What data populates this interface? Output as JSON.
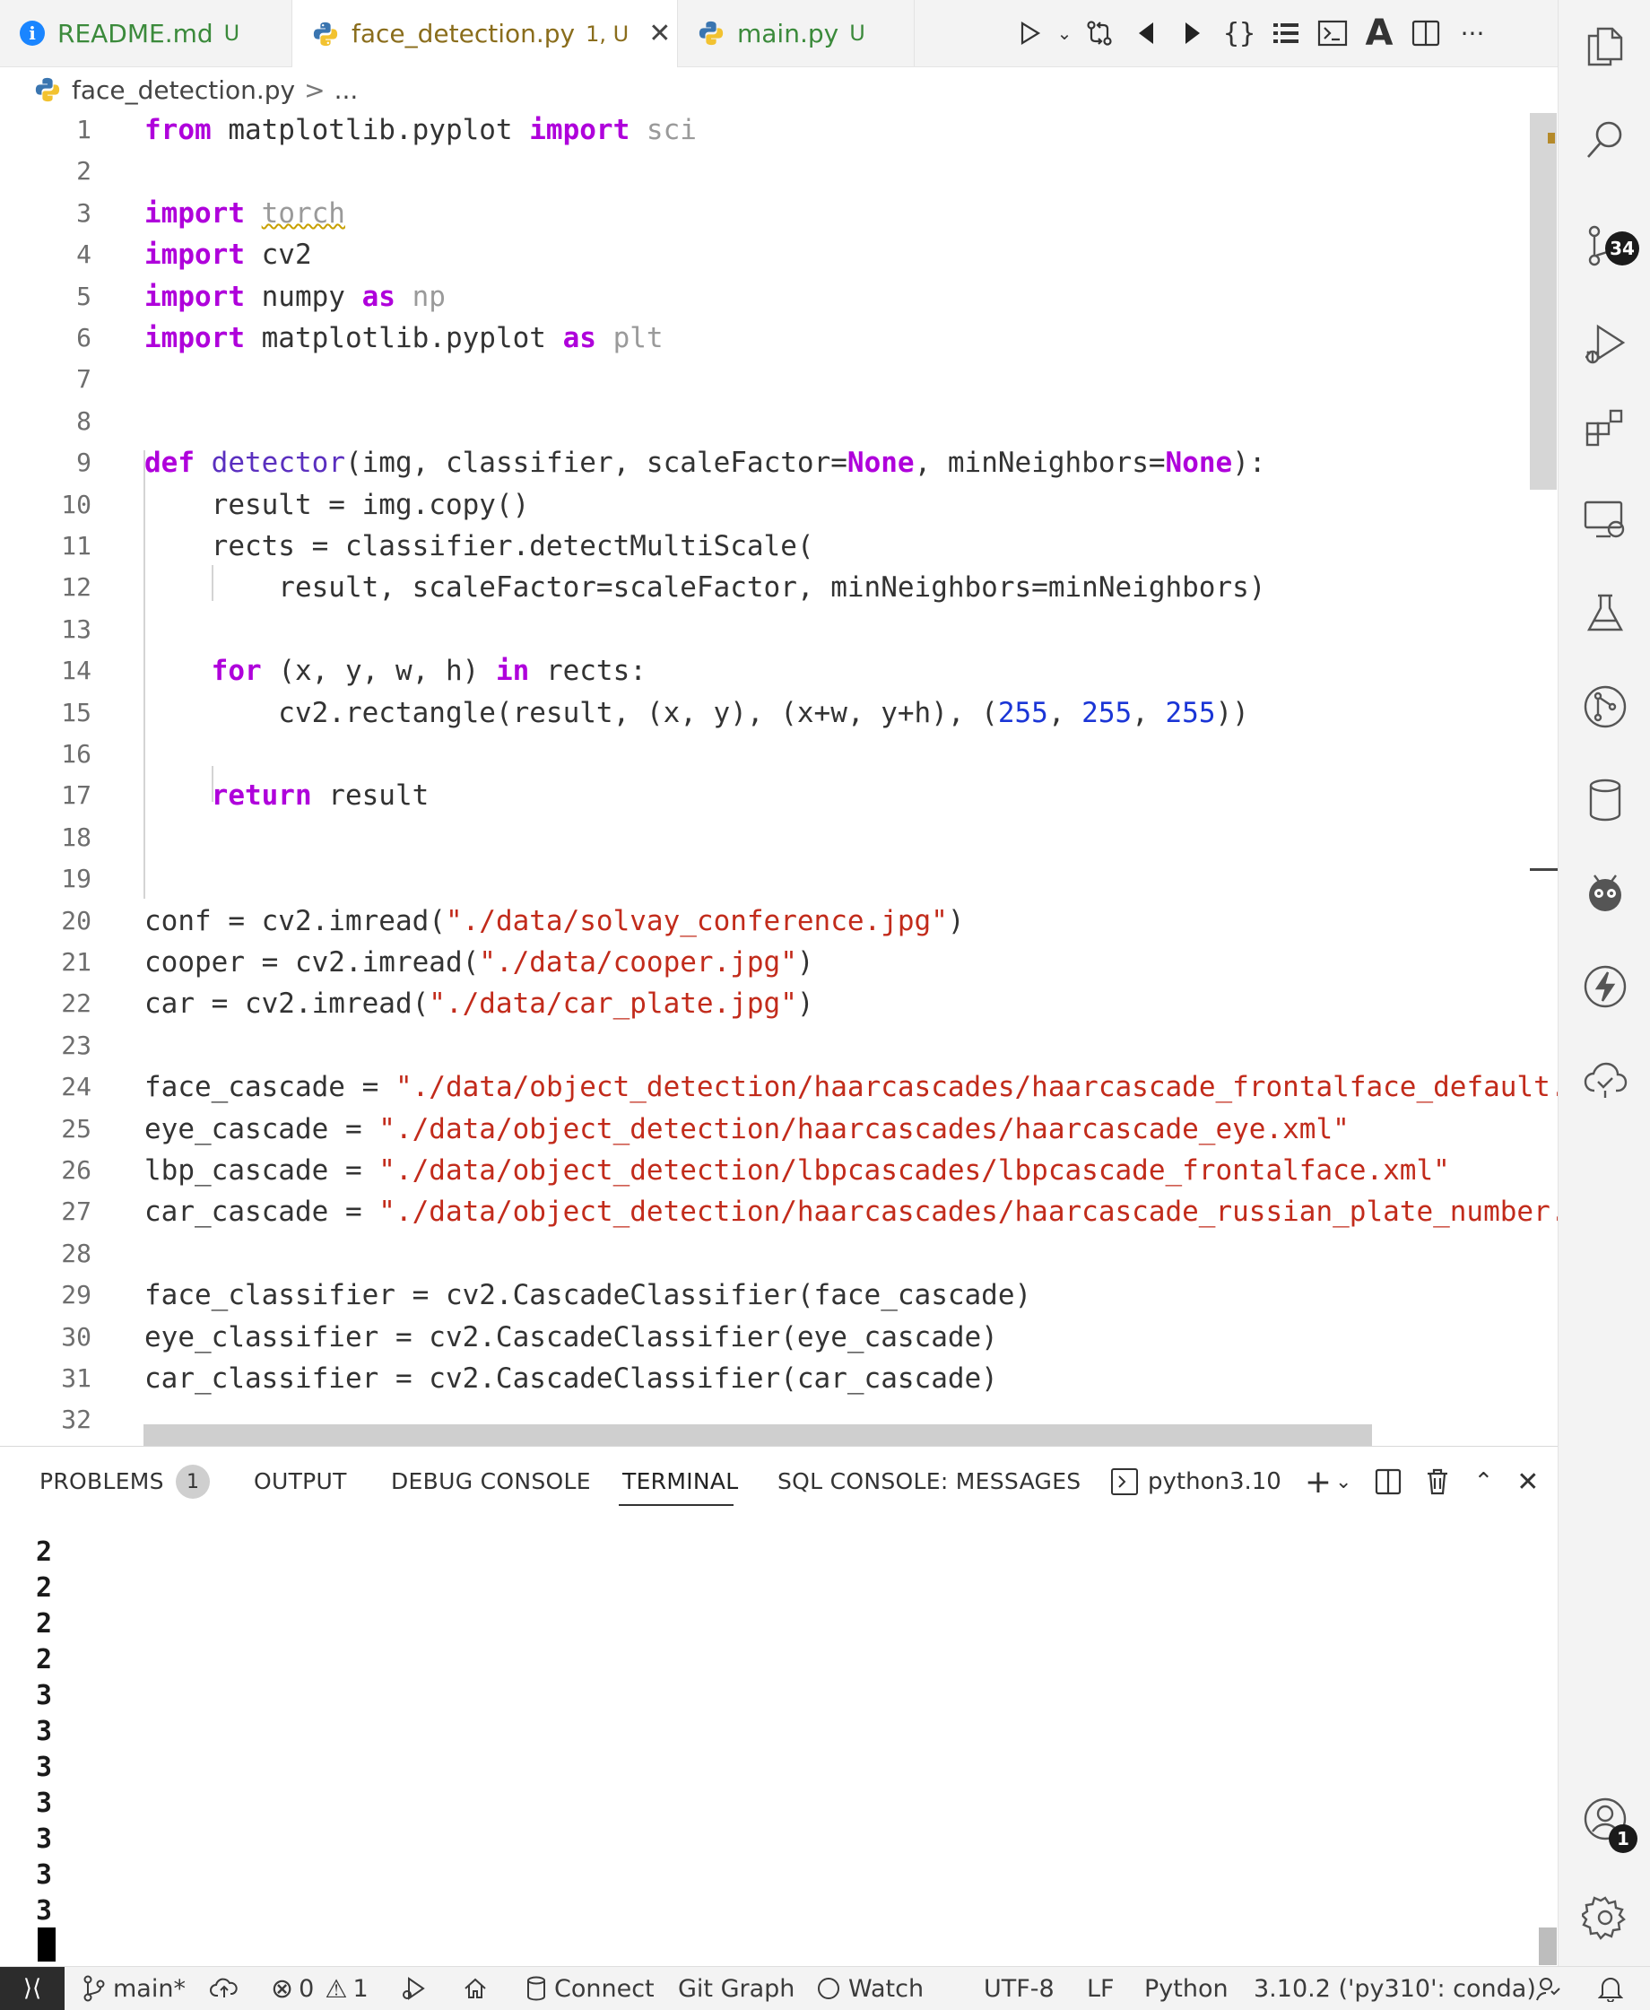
{
  "tabs": [
    {
      "name": "README.md",
      "status": "U",
      "icon": "info-icon"
    },
    {
      "name": "face_detection.py",
      "status": "1, U",
      "icon": "python-icon",
      "active": true
    },
    {
      "name": "main.py",
      "status": "U",
      "icon": "python-icon"
    }
  ],
  "breadcrumb": {
    "file": "face_detection.py",
    "sep": ">",
    "more": "..."
  },
  "editor_actions": [
    "run-icon",
    "chevron-down-icon",
    "compare-changes-icon",
    "previous-change-icon",
    "next-change-icon",
    "braces-icon",
    "list-icon",
    "terminal-icon",
    "font-icon",
    "split-editor-icon",
    "more-icon"
  ],
  "code_lines": [
    {
      "n": "1"
    },
    {
      "n": "2"
    },
    {
      "n": "3"
    },
    {
      "n": "4"
    },
    {
      "n": "5"
    },
    {
      "n": "6"
    },
    {
      "n": "7"
    },
    {
      "n": "8"
    },
    {
      "n": "9"
    },
    {
      "n": "10"
    },
    {
      "n": "11"
    },
    {
      "n": "12"
    },
    {
      "n": "13"
    },
    {
      "n": "14"
    },
    {
      "n": "15"
    },
    {
      "n": "16"
    },
    {
      "n": "17"
    },
    {
      "n": "18"
    },
    {
      "n": "19"
    },
    {
      "n": "20"
    },
    {
      "n": "21"
    },
    {
      "n": "22"
    },
    {
      "n": "23"
    },
    {
      "n": "24"
    },
    {
      "n": "25"
    },
    {
      "n": "26"
    },
    {
      "n": "27"
    },
    {
      "n": "28"
    },
    {
      "n": "29"
    },
    {
      "n": "30"
    },
    {
      "n": "31"
    },
    {
      "n": "32"
    }
  ],
  "code": {
    "l1": [
      [
        "kw",
        "from"
      ],
      [
        "t",
        " matplotlib.pyplot "
      ],
      [
        "kw",
        "import"
      ],
      [
        "dim",
        " sci"
      ]
    ],
    "l2": [],
    "l3": [
      [
        "kw",
        "import"
      ],
      [
        "t",
        " "
      ],
      [
        "dimsq",
        "torch"
      ]
    ],
    "l4": [
      [
        "kw",
        "import"
      ],
      [
        "t",
        " cv2"
      ]
    ],
    "l5": [
      [
        "kw",
        "import"
      ],
      [
        "t",
        " numpy "
      ],
      [
        "kw",
        "as"
      ],
      [
        "dim",
        " np"
      ]
    ],
    "l6": [
      [
        "kw",
        "import"
      ],
      [
        "t",
        " matplotlib.pyplot "
      ],
      [
        "kw",
        "as"
      ],
      [
        "dim",
        " plt"
      ]
    ],
    "l7": [],
    "l8": [],
    "l9": [
      [
        "kw",
        "def"
      ],
      [
        "t",
        " "
      ],
      [
        "fn",
        "detector"
      ],
      [
        "t",
        "(img, classifier, scaleFactor="
      ],
      [
        "kw",
        "None"
      ],
      [
        "t",
        ", minNeighbors="
      ],
      [
        "kw",
        "None"
      ],
      [
        "t",
        "):"
      ]
    ],
    "l10": [
      [
        "t",
        "    result = img.copy()"
      ]
    ],
    "l11": [
      [
        "t",
        "    rects = classifier.detectMultiScale("
      ]
    ],
    "l12": [
      [
        "t",
        "        result, scaleFactor=scaleFactor, minNeighbors=minNeighbors)"
      ]
    ],
    "l13": [],
    "l14": [
      [
        "t",
        "    "
      ],
      [
        "kw",
        "for"
      ],
      [
        "t",
        " (x, y, w, h) "
      ],
      [
        "kw",
        "in"
      ],
      [
        "t",
        " rects:"
      ]
    ],
    "l15": [
      [
        "t",
        "        cv2.rectangle(result, (x, y), (x+w, y+h), ("
      ],
      [
        "num",
        "255"
      ],
      [
        "t",
        ", "
      ],
      [
        "num",
        "255"
      ],
      [
        "t",
        ", "
      ],
      [
        "num",
        "255"
      ],
      [
        "t",
        "))"
      ]
    ],
    "l16": [],
    "l17": [
      [
        "t",
        "    "
      ],
      [
        "kw",
        "return"
      ],
      [
        "t",
        " result"
      ]
    ],
    "l18": [],
    "l19": [],
    "l20": [
      [
        "t",
        "conf = cv2.imread("
      ],
      [
        "str",
        "\"./data/solvay_conference.jpg\""
      ],
      [
        "t",
        ")"
      ]
    ],
    "l21": [
      [
        "t",
        "cooper = cv2.imread("
      ],
      [
        "str",
        "\"./data/cooper.jpg\""
      ],
      [
        "t",
        ")"
      ]
    ],
    "l22": [
      [
        "t",
        "car = cv2.imread("
      ],
      [
        "str",
        "\"./data/car_plate.jpg\""
      ],
      [
        "t",
        ")"
      ]
    ],
    "l23": [],
    "l24": [
      [
        "t",
        "face_cascade = "
      ],
      [
        "str",
        "\"./data/object_detection/haarcascades/haarcascade_frontalface_default.xml\""
      ]
    ],
    "l25": [
      [
        "t",
        "eye_cascade = "
      ],
      [
        "str",
        "\"./data/object_detection/haarcascades/haarcascade_eye.xml\""
      ]
    ],
    "l26": [
      [
        "t",
        "lbp_cascade = "
      ],
      [
        "str",
        "\"./data/object_detection/lbpcascades/lbpcascade_frontalface.xml\""
      ]
    ],
    "l27": [
      [
        "t",
        "car_cascade = "
      ],
      [
        "str",
        "\"./data/object_detection/haarcascades/haarcascade_russian_plate_number.xml\""
      ]
    ],
    "l28": [],
    "l29": [
      [
        "t",
        "face_classifier = cv2.CascadeClassifier(face_cascade)"
      ]
    ],
    "l30": [
      [
        "t",
        "eye_classifier = cv2.CascadeClassifier(eye_cascade)"
      ]
    ],
    "l31": [
      [
        "t",
        "car_classifier = cv2.CascadeClassifier(car_cascade)"
      ]
    ],
    "l32": []
  },
  "panel": {
    "tabs": {
      "problems": "PROBLEMS",
      "problems_count": "1",
      "output": "OUTPUT",
      "debug": "DEBUG CONSOLE",
      "terminal": "TERMINAL",
      "sql": "SQL CONSOLE: MESSAGES"
    },
    "shell": "python3.10",
    "terminal_output": [
      "2",
      "2",
      "2",
      "2",
      "3",
      "3",
      "3",
      "3",
      "3",
      "3",
      "3"
    ]
  },
  "activity_bar": [
    {
      "icon": "explorer-icon"
    },
    {
      "icon": "search-icon"
    },
    {
      "icon": "source-control-icon",
      "badge": "34"
    },
    {
      "icon": "run-debug-icon"
    },
    {
      "icon": "extensions-icon"
    },
    {
      "icon": "remote-explorer-icon"
    },
    {
      "icon": "testing-icon"
    },
    {
      "icon": "git-graph-icon"
    },
    {
      "icon": "database-icon"
    },
    {
      "icon": "platformio-icon"
    },
    {
      "icon": "thunder-client-icon"
    },
    {
      "icon": "cloud-check-icon"
    },
    {
      "icon": "accounts-icon",
      "badge": "1"
    },
    {
      "icon": "settings-gear-icon"
    }
  ],
  "status_bar": {
    "branch": "main*",
    "errors": "0",
    "warnings": "1",
    "connect": "Connect",
    "git_graph": "Git Graph",
    "watch": "Watch",
    "encoding": "UTF-8",
    "eol": "LF",
    "language": "Python",
    "interpreter": "3.10.2 ('py310': conda)"
  },
  "colors": {
    "keyword": "#af00db",
    "string": "#c22b1b",
    "number": "#1a35d6",
    "function": "#5a2fbf",
    "dim": "#9a9a9a",
    "accent": "#1a85ff"
  }
}
